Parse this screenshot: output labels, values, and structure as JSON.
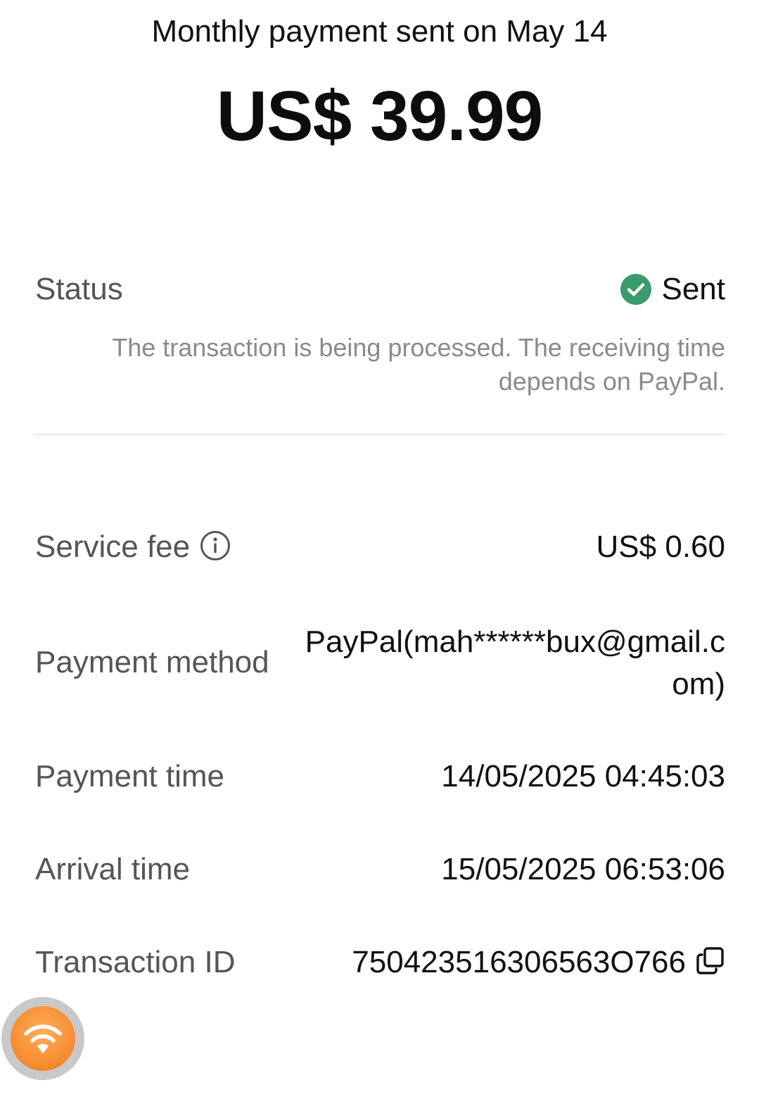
{
  "header": {
    "title": "Monthly payment sent on May 14",
    "amount": "US$ 39.99"
  },
  "status": {
    "label": "Status",
    "value": "Sent",
    "note": "The transaction is being processed. The receiving time depends on PayPal.",
    "color": "#3a9a6e"
  },
  "details": {
    "service_fee": {
      "label": "Service fee",
      "value": "US$ 0.60",
      "icon": "info-icon"
    },
    "payment_method": {
      "label": "Payment method",
      "value": "PayPal(mah******bux@gmail.com)"
    },
    "payment_time": {
      "label": "Payment time",
      "value": "14/05/2025 04:45:03"
    },
    "arrival_time": {
      "label": "Arrival time",
      "value": "15/05/2025 06:53:06"
    },
    "transaction_id": {
      "label": "Transaction ID",
      "value": "750423516306563O766",
      "icon": "copy-icon"
    }
  },
  "floating_button": {
    "icon": "wifi-icon",
    "color": "#f27a1a"
  }
}
